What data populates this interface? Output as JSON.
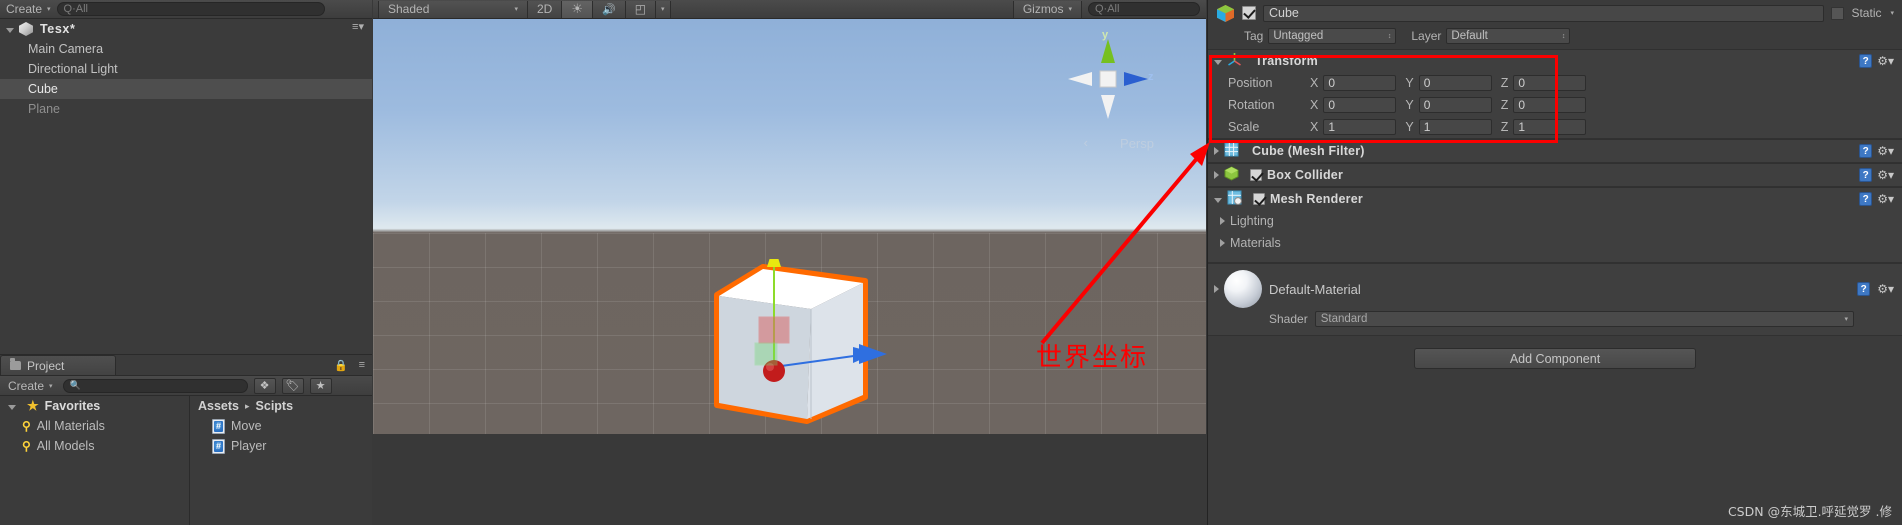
{
  "hierarchy": {
    "create_label": "Create",
    "create_caret": "▾",
    "search_placeholder": "Q·All",
    "menu_icon": "≡▾",
    "scene_name": "Tesx*",
    "objects": [
      {
        "label": "Main Camera",
        "selected": false,
        "dim": false
      },
      {
        "label": "Directional Light",
        "selected": false,
        "dim": false
      },
      {
        "label": "Cube",
        "selected": true,
        "dim": false
      },
      {
        "label": "Plane",
        "selected": false,
        "dim": true
      }
    ]
  },
  "scene": {
    "shading_mode": "Shaded",
    "shading_caret": "▾",
    "mode_2d": "2D",
    "light_icon": "☀",
    "audio_icon": "🔊",
    "effects_icon": "◰",
    "effects_caret": "▾",
    "gizmos_label": "Gizmos",
    "gizmos_caret": "▾",
    "search_placeholder": "Q·All",
    "persp_label": "Persp",
    "persp_arrow": "‹",
    "axis_y": "y",
    "axis_z": "z",
    "lock_icon": "🔓"
  },
  "inspector": {
    "object_name": "Cube",
    "enabled": true,
    "static_label": "Static",
    "static_caret": "▾",
    "tag_label": "Tag",
    "tag_value": "Untagged",
    "layer_label": "Layer",
    "layer_value": "Default",
    "stepper": "↕",
    "help_glyph": "?",
    "gear_glyph": "⚙▾",
    "transform": {
      "title": "Transform",
      "rows": [
        {
          "label": "Position",
          "x": "0",
          "y": "0",
          "z": "0"
        },
        {
          "label": "Rotation",
          "x": "0",
          "y": "0",
          "z": "0"
        },
        {
          "label": "Scale",
          "x": "1",
          "y": "1",
          "z": "1"
        }
      ],
      "axis_labels": [
        "X",
        "Y",
        "Z"
      ]
    },
    "components": [
      {
        "title": "Cube (Mesh Filter)",
        "expanded": false,
        "has_checkbox": false,
        "checked": false,
        "icon": "mesh-filter"
      },
      {
        "title": "Box Collider",
        "expanded": false,
        "has_checkbox": true,
        "checked": true,
        "icon": "box-collider"
      },
      {
        "title": "Mesh Renderer",
        "expanded": true,
        "has_checkbox": true,
        "checked": true,
        "icon": "mesh-renderer"
      }
    ],
    "mesh_renderer_sections": [
      {
        "label": "Lighting"
      },
      {
        "label": "Materials"
      }
    ],
    "material": {
      "name": "Default-Material",
      "shader_label": "Shader",
      "shader_value": "Standard",
      "shader_caret": "▾"
    },
    "add_component_label": "Add Component"
  },
  "project": {
    "tab_label": "Project",
    "lock_icon": "🔒",
    "menu_icon": "≡",
    "create_label": "Create",
    "create_caret": "▾",
    "search_placeholder": "",
    "search_icon": "🔍",
    "icon_buttons": [
      "❖",
      "🏷",
      "★"
    ],
    "favorites_label": "Favorites",
    "favorites": [
      {
        "label": "All Materials"
      },
      {
        "label": "All Models"
      }
    ],
    "breadcrumb": {
      "root": "Assets",
      "sep": "▸",
      "current": "Scipts"
    },
    "files": [
      {
        "label": "Move",
        "type": "csharp"
      },
      {
        "label": "Player",
        "type": "csharp"
      }
    ]
  },
  "annotation": {
    "text": "世界坐标",
    "color": "#fb0000"
  },
  "watermark": {
    "text": "CSDN @东城卫.呼延觉罗 .修"
  }
}
